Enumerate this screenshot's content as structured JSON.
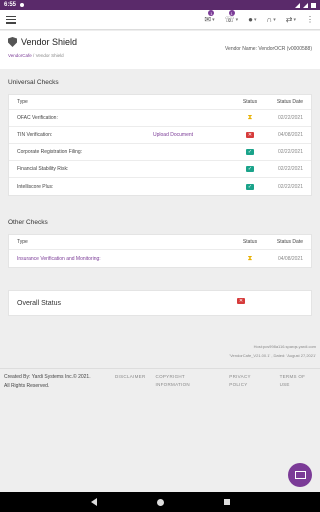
{
  "status_bar": {
    "time": "6:55"
  },
  "topbar": {
    "mail_badge": "1",
    "notif_badge": "1"
  },
  "header": {
    "title": "Vendor Shield",
    "breadcrumb_home": "VendorCafe",
    "breadcrumb_sep": "/",
    "breadcrumb_current": "Vendor Shield",
    "vendor_label": "Vendor Name:",
    "vendor_value": "VendorOCR (v0000588)"
  },
  "universal": {
    "title": "Universal Checks",
    "headers": {
      "type": "Type",
      "status": "Status",
      "date": "Status Date"
    },
    "rows": [
      {
        "type": "OFAC Verification:",
        "link": "",
        "status": "pending",
        "date": "02/22/2021"
      },
      {
        "type": "TIN Verification:",
        "link": "Upload Document",
        "status": "fail",
        "date": "04/08/2021"
      },
      {
        "type": "Corporate Registration Filing:",
        "link": "",
        "status": "ok",
        "date": "02/22/2021"
      },
      {
        "type": "Financial Stability Risk:",
        "link": "",
        "status": "ok",
        "date": "02/22/2021"
      },
      {
        "type": "Intelliscore Plus:",
        "link": "",
        "status": "ok",
        "date": "02/22/2021"
      }
    ]
  },
  "other": {
    "title": "Other Checks",
    "headers": {
      "type": "Type",
      "status": "Status",
      "date": "Status Date"
    },
    "rows": [
      {
        "type": "Insurance Verification and Monitoring:",
        "status": "pending",
        "date": "04/08/2021"
      }
    ]
  },
  "overall": {
    "title": "Overall Status",
    "status": "fail"
  },
  "host": {
    "line1": "Host:pcs998a116.sparqs.yardi.com",
    "line2": "'VendorCafe_V21.00.1' , Dated: 'August 27,2021'"
  },
  "footer": {
    "created": "Created By: Yardi Systems Inc.© 2021.",
    "rights": "All Rights Reserved.",
    "links": [
      "DISCLAIMER",
      "COPYRIGHT INFORMATION",
      "PRIVACY POLICY",
      "TERMS OF USE"
    ]
  },
  "colors": {
    "accent": "#7b3b97",
    "ok": "#1aa38a",
    "fail": "#d63b3b",
    "pending": "#e8b000"
  }
}
